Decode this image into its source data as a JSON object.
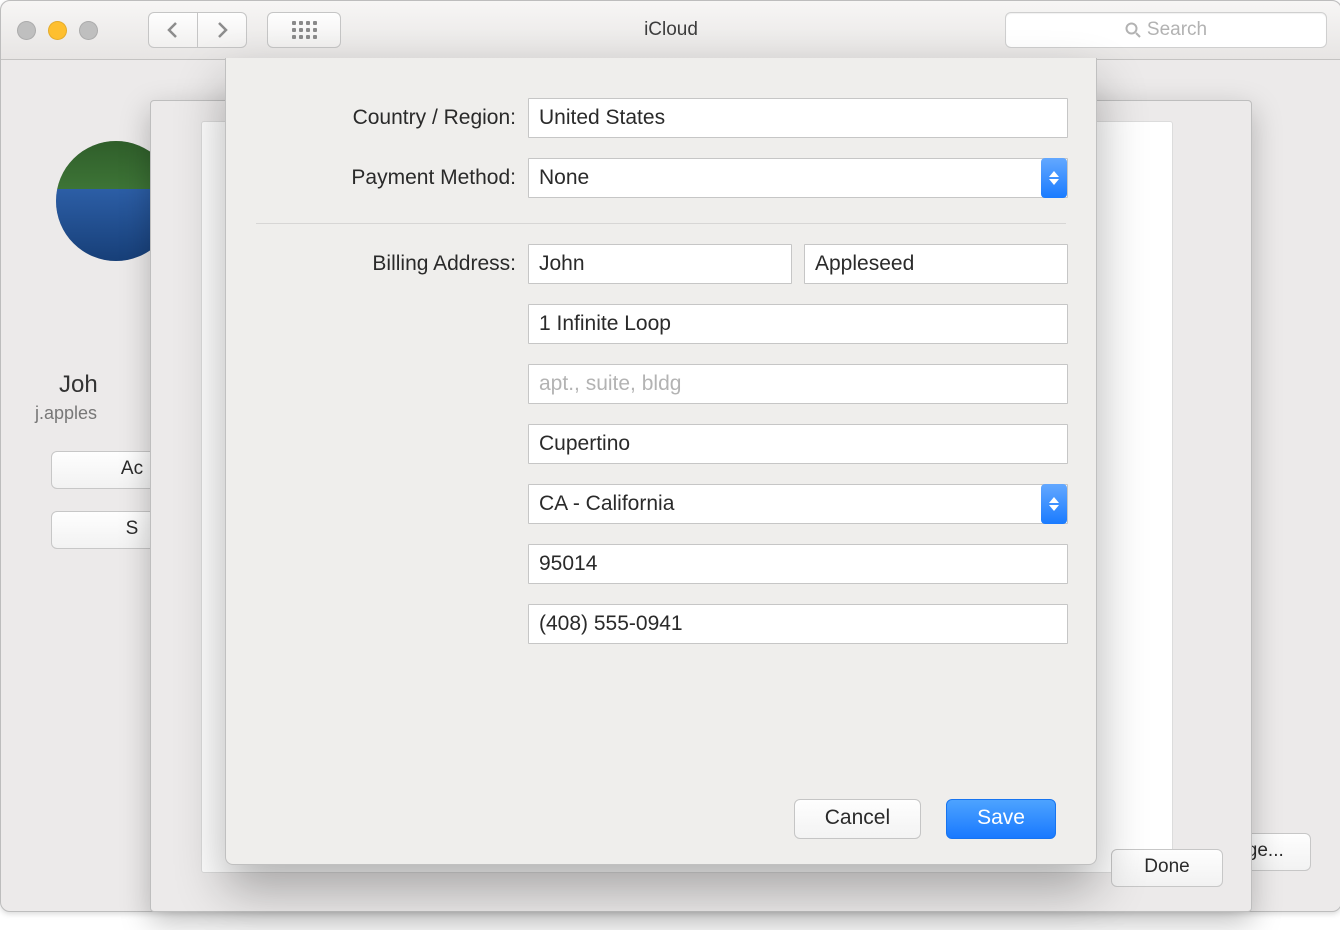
{
  "window": {
    "title": "iCloud",
    "search_placeholder": "Search"
  },
  "background": {
    "user_name_partial": "Joh",
    "user_email_partial": "j.apples",
    "account_btn_partial": "Ac",
    "signout_btn_partial": "S",
    "manage_btn_partial": "age...",
    "done_btn": "Done"
  },
  "modal": {
    "labels": {
      "country": "Country / Region:",
      "payment": "Payment Method:",
      "billing": "Billing Address:"
    },
    "country_value": "United States",
    "payment_value": "None",
    "first_name": "John",
    "last_name": "Appleseed",
    "street1": "1 Infinite Loop",
    "street2_placeholder": "apt., suite, bldg",
    "city": "Cupertino",
    "state_value": "CA - California",
    "postal": "95014",
    "phone": "(408) 555-0941",
    "cancel": "Cancel",
    "save": "Save"
  }
}
